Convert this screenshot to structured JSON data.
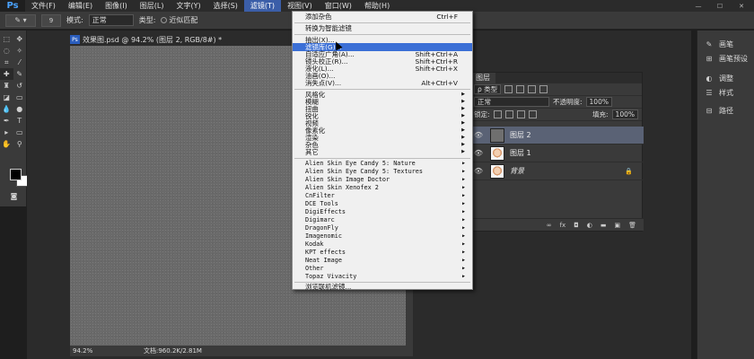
{
  "menubar": {
    "logo": "Ps",
    "items": [
      "文件(F)",
      "编辑(E)",
      "图像(I)",
      "图层(L)",
      "文字(Y)",
      "选择(S)",
      "滤镜(T)",
      "视图(V)",
      "窗口(W)",
      "帮助(H)"
    ],
    "window_controls": [
      "—",
      "☐",
      "✕"
    ]
  },
  "options": {
    "brush_size": "9",
    "mode_label": "模式:",
    "mode_value": "正常",
    "type_label": "类型:",
    "radio1": "近似匹配"
  },
  "document": {
    "tab_title": "效果图.psd @ 94.2% (图层 2, RGB/8#) *",
    "zoom": "94.2%",
    "doc_info": "文档:960.2K/2.81M"
  },
  "filter_menu": {
    "top_items": [
      {
        "label": "添加杂色",
        "shortcut": "Ctrl+F"
      },
      {
        "label": "转换为智能滤镜",
        "shortcut": ""
      }
    ],
    "group2": [
      {
        "label": "抽出(X)...",
        "shortcut": ""
      },
      {
        "label": "滤镜库(G)...",
        "shortcut": ""
      },
      {
        "label": "自适应广角(A)...",
        "shortcut": "Shift+Ctrl+A"
      },
      {
        "label": "镜头校正(R)...",
        "shortcut": "Shift+Ctrl+R"
      },
      {
        "label": "液化(L)...",
        "shortcut": "Shift+Ctrl+X"
      },
      {
        "label": "油画(O)...",
        "shortcut": ""
      },
      {
        "label": "消失点(V)...",
        "shortcut": "Alt+Ctrl+V"
      }
    ],
    "group3": [
      "风格化",
      "模糊",
      "扭曲",
      "锐化",
      "视频",
      "像素化",
      "渲染",
      "杂色",
      "其它"
    ],
    "group4": [
      "Alien Skin Eye Candy 5: Nature",
      "Alien Skin Eye Candy 5: Textures",
      "Alien Skin Image Doctor",
      "Alien Skin Xenofex 2",
      "CnFilter",
      "DCE Tools",
      "DigiEffects",
      "Digimarc",
      "DragonFly",
      "Imagenomic",
      "Kodak",
      "KPT effects",
      "Neat Image",
      "Other",
      "Topaz Vivacity"
    ],
    "bottom": "浏览联机滤镜..."
  },
  "layers": {
    "tab": "图层",
    "kind_label": "ρ 类型",
    "blend": "正常",
    "opacity_label": "不透明度:",
    "opacity": "100%",
    "lock_label": "锁定:",
    "fill_label": "填充:",
    "fill": "100%",
    "items": [
      {
        "name": "图层 2",
        "selected": true,
        "thumb": "gray"
      },
      {
        "name": "图层 1",
        "selected": false,
        "thumb": "face"
      },
      {
        "name": "背景",
        "selected": false,
        "thumb": "face"
      }
    ],
    "footer_icons": [
      "∞",
      "fx",
      "◘",
      "◐",
      "▬",
      "▣",
      "🗑"
    ]
  },
  "dock": {
    "items": [
      {
        "icon": "✎",
        "label": "画笔"
      },
      {
        "icon": "⊞",
        "label": "画笔预设"
      },
      {
        "icon": "◐",
        "label": "调整"
      },
      {
        "icon": "☰",
        "label": "样式"
      },
      {
        "icon": "⊟",
        "label": "路径"
      }
    ]
  }
}
